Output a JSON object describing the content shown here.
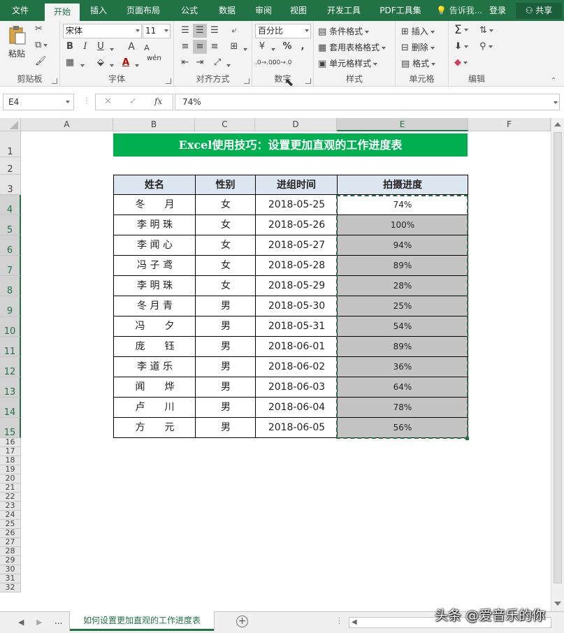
{
  "ribbon_tabs": [
    "文件",
    "开始",
    "插入",
    "页面布局",
    "公式",
    "数据",
    "审阅",
    "视图",
    "开发工具",
    "PDF工具集"
  ],
  "active_tab": "开始",
  "tell_me": "告诉我...",
  "login": "登录",
  "share": "共享",
  "groups": {
    "clipboard": {
      "label": "剪贴板",
      "paste": "粘贴"
    },
    "font": {
      "label": "字体",
      "name": "宋体",
      "size": "11",
      "bold": "B",
      "italic": "I",
      "underline": "U",
      "grow": "A",
      "shrink": "A",
      "fontcolor": "A",
      "phonetic": "wén"
    },
    "align": {
      "label": "对齐方式"
    },
    "number": {
      "label": "数字",
      "format": "百分比",
      "percent": "%",
      "comma": ",",
      "inc_dec": "←.0 .00",
      "dec_dec": ".00 →.0"
    },
    "styles": {
      "label": "样式",
      "conditional": "条件格式",
      "table": "套用表格格式",
      "cell": "单元格样式"
    },
    "cells": {
      "label": "单元格",
      "insert": "插入",
      "delete": "删除",
      "format": "格式"
    },
    "editing": {
      "label": "编辑",
      "sum": "Σ"
    }
  },
  "formula_bar": {
    "name_box": "E4",
    "fx": "fx",
    "value": "74%"
  },
  "columns": [
    "A",
    "B",
    "C",
    "D",
    "E",
    "F"
  ],
  "rows": [
    "1",
    "2",
    "3",
    "4",
    "5",
    "6",
    "7",
    "8",
    "9",
    "10",
    "11",
    "12",
    "13",
    "14",
    "15",
    "16",
    "17",
    "18",
    "19",
    "20",
    "21",
    "22",
    "23",
    "24",
    "25",
    "26",
    "27",
    "28",
    "29",
    "30",
    "31",
    "32"
  ],
  "sheet": {
    "title": "Excel使用技巧：设置更加直观的工作进度表",
    "headers": [
      "姓名",
      "性别",
      "进组时间",
      "拍摄进度"
    ],
    "records": [
      {
        "name": "冬　　月",
        "gender": "女",
        "date": "2018-05-25",
        "progress": "74%"
      },
      {
        "name": "李 明 珠",
        "gender": "女",
        "date": "2018-05-26",
        "progress": "100%"
      },
      {
        "name": "李 闻 心",
        "gender": "女",
        "date": "2018-05-27",
        "progress": "94%"
      },
      {
        "name": "冯 子 鸢",
        "gender": "女",
        "date": "2018-05-28",
        "progress": "89%"
      },
      {
        "name": "李 明 珠",
        "gender": "女",
        "date": "2018-05-29",
        "progress": "28%"
      },
      {
        "name": "冬 月 青",
        "gender": "男",
        "date": "2018-05-30",
        "progress": "25%"
      },
      {
        "name": "冯　　夕",
        "gender": "男",
        "date": "2018-05-31",
        "progress": "54%"
      },
      {
        "name": "庞　　钰",
        "gender": "男",
        "date": "2018-06-01",
        "progress": "89%"
      },
      {
        "name": "李 道 乐",
        "gender": "男",
        "date": "2018-06-02",
        "progress": "36%"
      },
      {
        "name": "闻　　烨",
        "gender": "男",
        "date": "2018-06-03",
        "progress": "64%"
      },
      {
        "name": "卢　　川",
        "gender": "男",
        "date": "2018-06-04",
        "progress": "78%"
      },
      {
        "name": "方　　元",
        "gender": "男",
        "date": "2018-06-05",
        "progress": "56%"
      }
    ]
  },
  "sheet_tab": "如何设置更加直观的工作进度表",
  "nav_more": "...",
  "watermark": "头条 @爱音乐的你",
  "colors": {
    "accent": "#217346",
    "title_fill": "#00b050",
    "header_fill": "#dce6f1",
    "progress_fill": "#c4c4c4"
  }
}
